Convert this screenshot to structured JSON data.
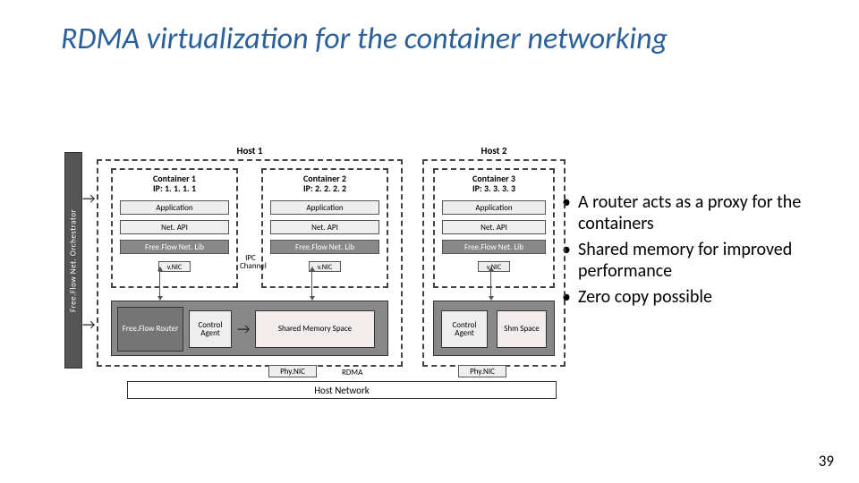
{
  "title": "RDMA virtualization for the container networking",
  "page_number": "39",
  "bullets": [
    "A router acts as a proxy for the containers",
    "Shared memory for improved performance",
    "Zero copy possible"
  ],
  "diagram": {
    "orchestrator": "Free.Flow Net. Orchestrator",
    "hosts": {
      "host1": {
        "label": "Host 1"
      },
      "host2": {
        "label": "Host 2"
      }
    },
    "containers": {
      "c1": {
        "name": "Container 1",
        "ip": "IP: 1. 1. 1. 1"
      },
      "c2": {
        "name": "Container 2",
        "ip": "IP: 2. 2. 2. 2"
      },
      "c3": {
        "name": "Container 3",
        "ip": "IP: 3. 3. 3. 3"
      }
    },
    "stack": {
      "app": "Application",
      "netapi": "Net. API",
      "fflib": "Free.Flow Net. Lib",
      "vnic": "v.NIC"
    },
    "router_zone": {
      "ffrouter": "Free.Flow Router",
      "ctrl": "Control Agent",
      "shmem": "Shared Memory Space",
      "shm": "Shm Space"
    },
    "labels": {
      "ipc": "IPC Channel",
      "rdma": "RDMA",
      "phynic": "Phy.NIC",
      "hostnet": "Host Network"
    }
  }
}
